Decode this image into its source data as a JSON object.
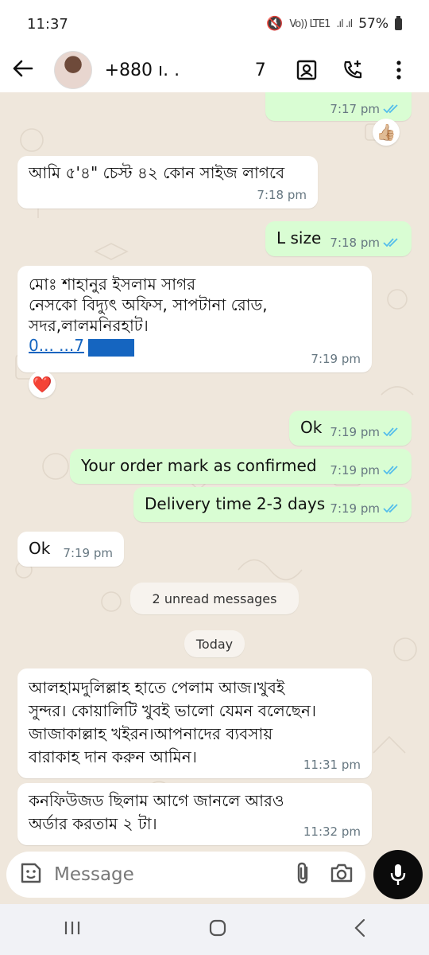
{
  "status_bar": {
    "time": "11:37",
    "network": "Vo)) LTE1",
    "signal": ".ıl .ıl",
    "battery": "57%"
  },
  "header": {
    "contact": "+880 ı.  .",
    "contact_suffix": "7"
  },
  "messages": [
    {
      "id": "m1",
      "dir": "out",
      "text": "",
      "time": "7:17 pm",
      "reaction": "👍🏼"
    },
    {
      "id": "m2",
      "dir": "in",
      "text": "আমি ৫'৪\" চেস্ট ৪২ কোন সাইজ লাগবে",
      "time": "7:18 pm"
    },
    {
      "id": "m3",
      "dir": "out",
      "text": "L size",
      "time": "7:18 pm"
    },
    {
      "id": "m4",
      "dir": "in",
      "text": "মোঃ শাহানুর ইসলাম সাগর\nনেসকো বিদ্যুৎ অফিস, সাপটানা রোড,\nসদর,লালমনিরহাট।",
      "phone": "0...  ...7",
      "time": "7:19 pm",
      "reaction": "❤️"
    },
    {
      "id": "m5",
      "dir": "out",
      "text": "Ok",
      "time": "7:19 pm"
    },
    {
      "id": "m6",
      "dir": "out",
      "text": "Your order mark as confirmed",
      "time": "7:19 pm"
    },
    {
      "id": "m7",
      "dir": "out",
      "text": "Delivery time 2-3 days",
      "time": "7:19 pm"
    },
    {
      "id": "m8",
      "dir": "in",
      "text": "Ok",
      "time": "7:19 pm"
    },
    {
      "id": "m9",
      "dir": "in",
      "text": "আলহামদুলিল্লাহ হাতে পেলাম আজ।খুবই\nসুন্দর। কোয়ালিটি খুবই ভালো যেমন বলেছেন।\nজাজাকাল্লাহ খইরন।আপনাদের ব্যবসায়\nবারাকাহ দান করুন আমিন।",
      "time": "11:31 pm"
    },
    {
      "id": "m10",
      "dir": "in",
      "text": "কনফিউজড ছিলাম আগে জানলে আরও\nঅর্ডার করতাম ২ টা।",
      "time": "11:32 pm"
    }
  ],
  "unread_chip": "2 unread messages",
  "date_chip": "Today",
  "composer": {
    "placeholder": "Message"
  },
  "colors": {
    "outgoing": "#d9fdd3",
    "incoming": "#ffffff",
    "tick": "#53bdeb",
    "wallpaper": "#efe7dc"
  }
}
